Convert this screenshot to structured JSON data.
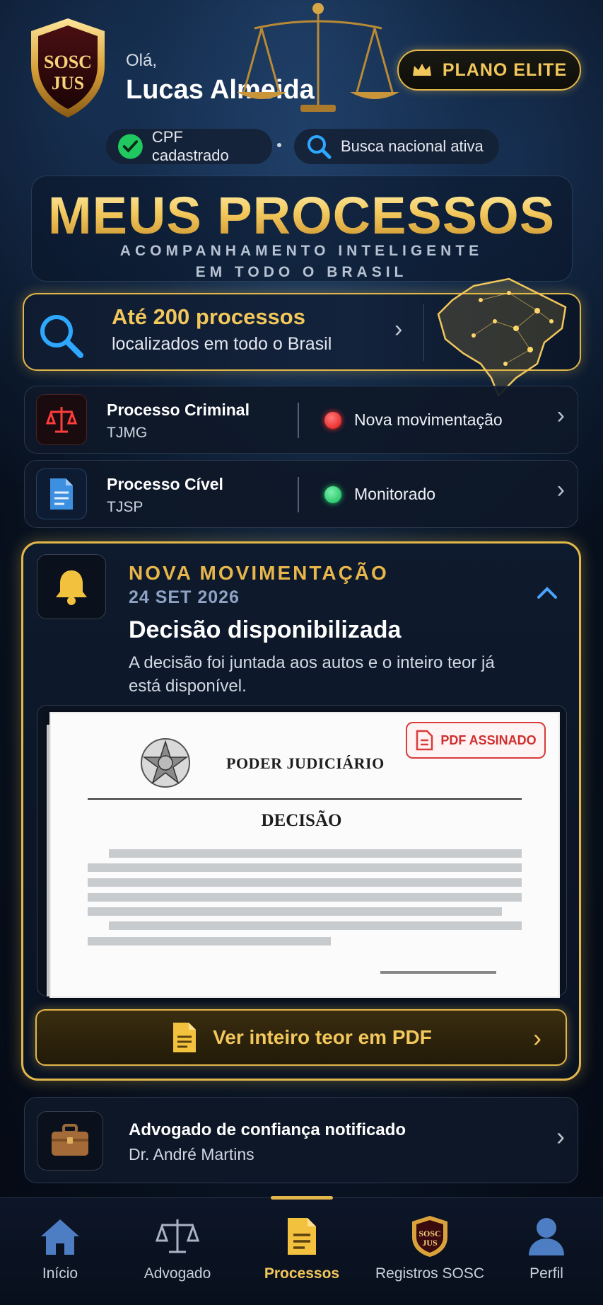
{
  "header": {
    "logo_text": "SOSC JUS",
    "greeting": "Olá,",
    "user_name": "Lucas Almeida",
    "plan_label": "PLANO ELITE",
    "cpf_status": "CPF cadastrado",
    "search_status": "Busca nacional ativa"
  },
  "hero": {
    "title": "MEUS PROCESSOS",
    "subtitle_line1": "ACOMPANHAMENTO INTELIGENTE",
    "subtitle_line2": "EM TODO O BRASIL"
  },
  "search_card": {
    "title": "Até 200 processos",
    "subtitle": "localizados em todo o Brasil"
  },
  "processes": [
    {
      "title": "Processo Criminal",
      "court": "TJMG",
      "status": "Nova movimentação",
      "status_color": "#ff2e2e"
    },
    {
      "title": "Processo Cível",
      "court": "TJSP",
      "status": "Monitorado",
      "status_color": "#1fd26a"
    }
  ],
  "movement": {
    "label": "NOVA MOVIMENTAÇÃO",
    "date": "24 SET 2026",
    "heading": "Decisão disponibilizada",
    "description": "A decisão foi juntada aos autos e o inteiro teor já está disponível.",
    "document": {
      "header": "PODER JUDICIÁRIO",
      "title": "DECISÃO",
      "badge": "PDF ASSINADO"
    },
    "pdf_button": "Ver inteiro teor em PDF"
  },
  "lawyer": {
    "title": "Advogado de confiança notificado",
    "name": "Dr. André Martins"
  },
  "nav": {
    "items": [
      {
        "label": "Início",
        "icon": "home-icon"
      },
      {
        "label": "Advogado",
        "icon": "scales-icon"
      },
      {
        "label": "Processos",
        "icon": "document-icon",
        "active": true
      },
      {
        "label": "Registros SOSC",
        "icon": "sosc-shield-icon"
      },
      {
        "label": "Perfil",
        "icon": "user-icon"
      }
    ]
  },
  "colors": {
    "gold": "#e2b74a",
    "gold_text": "#f2c75b",
    "background": "#0b1a2e",
    "alert_red": "#ff2e2e",
    "ok_green": "#1fd26a"
  }
}
